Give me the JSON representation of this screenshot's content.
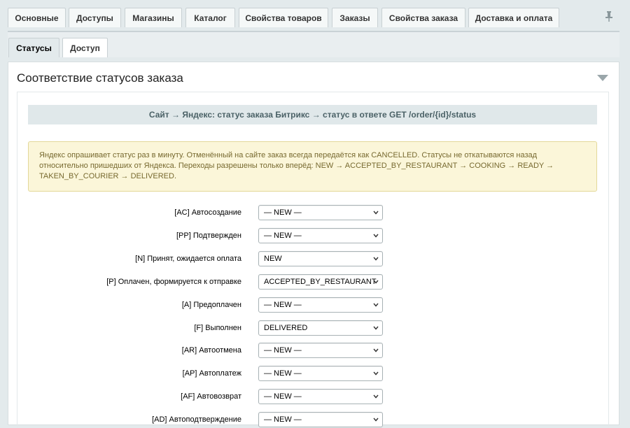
{
  "tabs": {
    "top": [
      "Основные",
      "Доступы",
      "Магазины",
      "Каталог",
      "Свойства товаров",
      "Заказы",
      "Свойства заказа",
      "Доставка и оплата"
    ],
    "sub": [
      "Статусы",
      "Доступ"
    ]
  },
  "panel": {
    "title": "Соответствие статусов заказа",
    "section_header": "Сайт → Яндекс: статус заказа Битрикс → статус в ответе GET /order/{id}/status",
    "notice": "Яндекс опрашивает статус раз в минуту. Отменённый на сайте заказ всегда передаётся как CANCELLED. Статусы не откатываются назад относительно пришедших от Яндекса. Переходы разрешены только вперёд: NEW → ACCEPTED_BY_RESTAURANT → COOKING → READY → TAKEN_BY_COURIER → DELIVERED."
  },
  "status_rows": [
    {
      "label": "[AC] Автосоздание",
      "value": "— NEW —"
    },
    {
      "label": "[PP] Подтвержден",
      "value": "— NEW —"
    },
    {
      "label": "[N] Принят, ожидается оплата",
      "value": "NEW"
    },
    {
      "label": "[P] Оплачен, формируется к отправке",
      "value": "ACCEPTED_BY_RESTAURANT"
    },
    {
      "label": "[A] Предоплачен",
      "value": "— NEW —"
    },
    {
      "label": "[F] Выполнен",
      "value": "DELIVERED"
    },
    {
      "label": "[AR] Автоотмена",
      "value": "— NEW —"
    },
    {
      "label": "[AP] Автоплатеж",
      "value": "— NEW —"
    },
    {
      "label": "[AF] Автовозврат",
      "value": "— NEW —"
    },
    {
      "label": "[AD] Автоподтверждение",
      "value": "— NEW —"
    }
  ]
}
